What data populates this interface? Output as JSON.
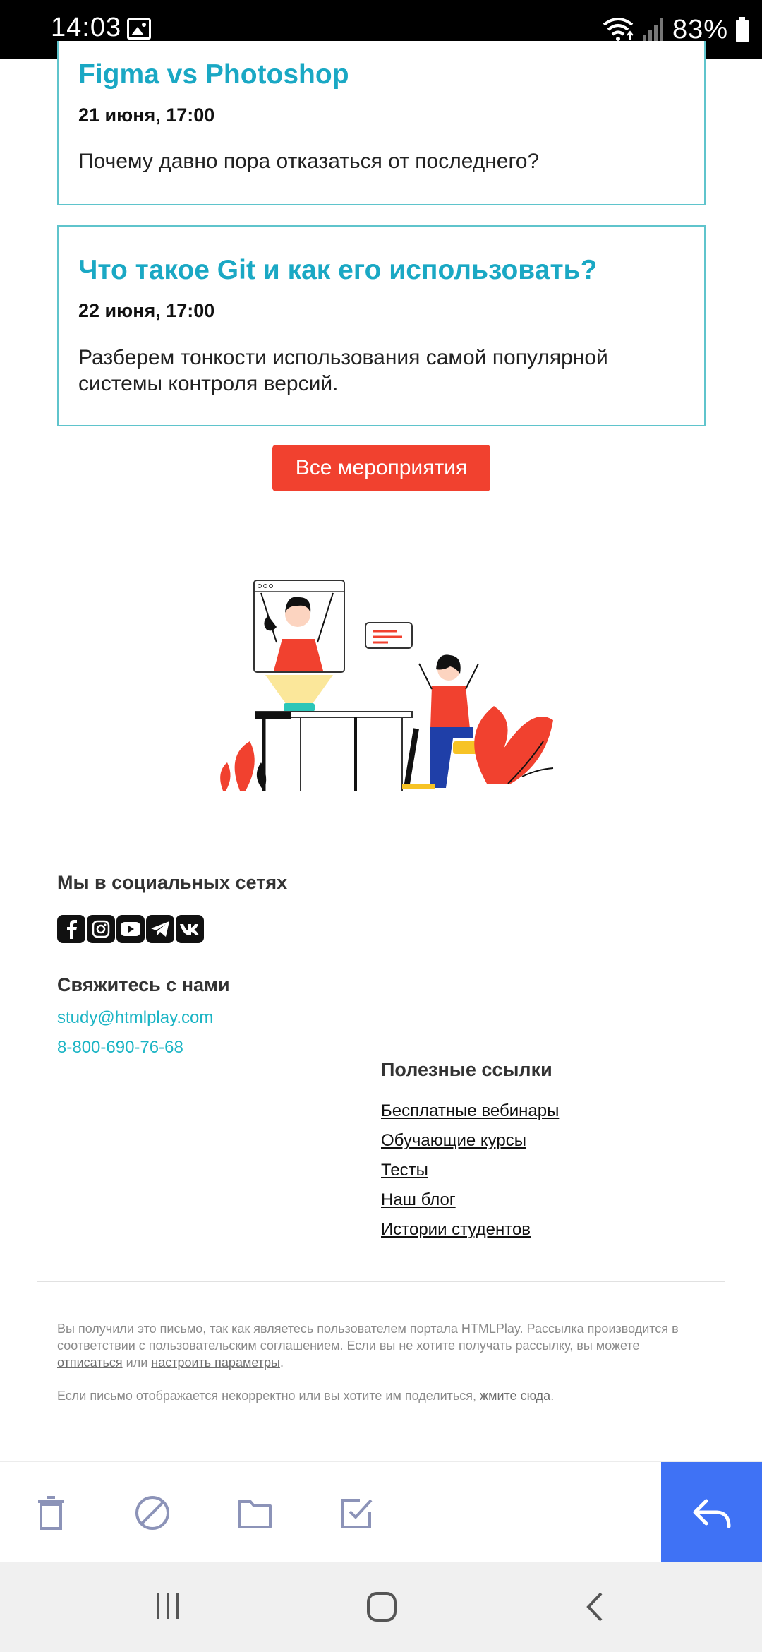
{
  "status_bar": {
    "time": "14:03",
    "battery": "83%"
  },
  "events": [
    {
      "title": "Figma vs Photoshop",
      "date": "21 июня, 17:00",
      "description": "Почему давно пора отказаться от последнего?"
    },
    {
      "title": "Что такое Git и как его использовать?",
      "date": "22 июня, 17:00",
      "description": "Разберем тонкости использования самой популярной системы контроля версий."
    }
  ],
  "cta_button": "Все мероприятия",
  "social": {
    "heading": "Мы в социальных сетях",
    "networks": [
      "facebook-icon",
      "instagram-icon",
      "youtube-icon",
      "telegram-icon",
      "vk-icon"
    ]
  },
  "contacts": {
    "heading": "Свяжитесь с нами",
    "email": "study@htmlplay.com",
    "phone": "8-800-690-76-68"
  },
  "useful_links": {
    "heading": "Полезные ссылки",
    "items": [
      "Бесплатные вебинары",
      "Обучающие курсы",
      "Тесты",
      "Наш блог",
      "Истории студентов"
    ]
  },
  "footer": {
    "p1_a": "Вы получили это письмо, так как являетесь пользователем портала HTMLPlay. Рассылка производится в соответствии с пользовательским соглашением. Если вы не хотите получать рассылку, вы можете ",
    "unsubscribe": "отписаться",
    "p1_b": " или ",
    "settings": "настроить параметры",
    "p1_c": ".",
    "p2_a": "Если письмо отображается некорректно или вы хотите им поделиться, ",
    "click_here": "жмите сюда",
    "p2_b": "."
  },
  "toolbar_icons": [
    "trash-icon",
    "block-icon",
    "folder-icon",
    "mark-done-icon",
    "reply-icon"
  ],
  "colors": {
    "accent": "#1aa8c4",
    "button": "#f1412f",
    "reply": "#3f72f5",
    "toolbar_icon": "#8c93b8"
  }
}
